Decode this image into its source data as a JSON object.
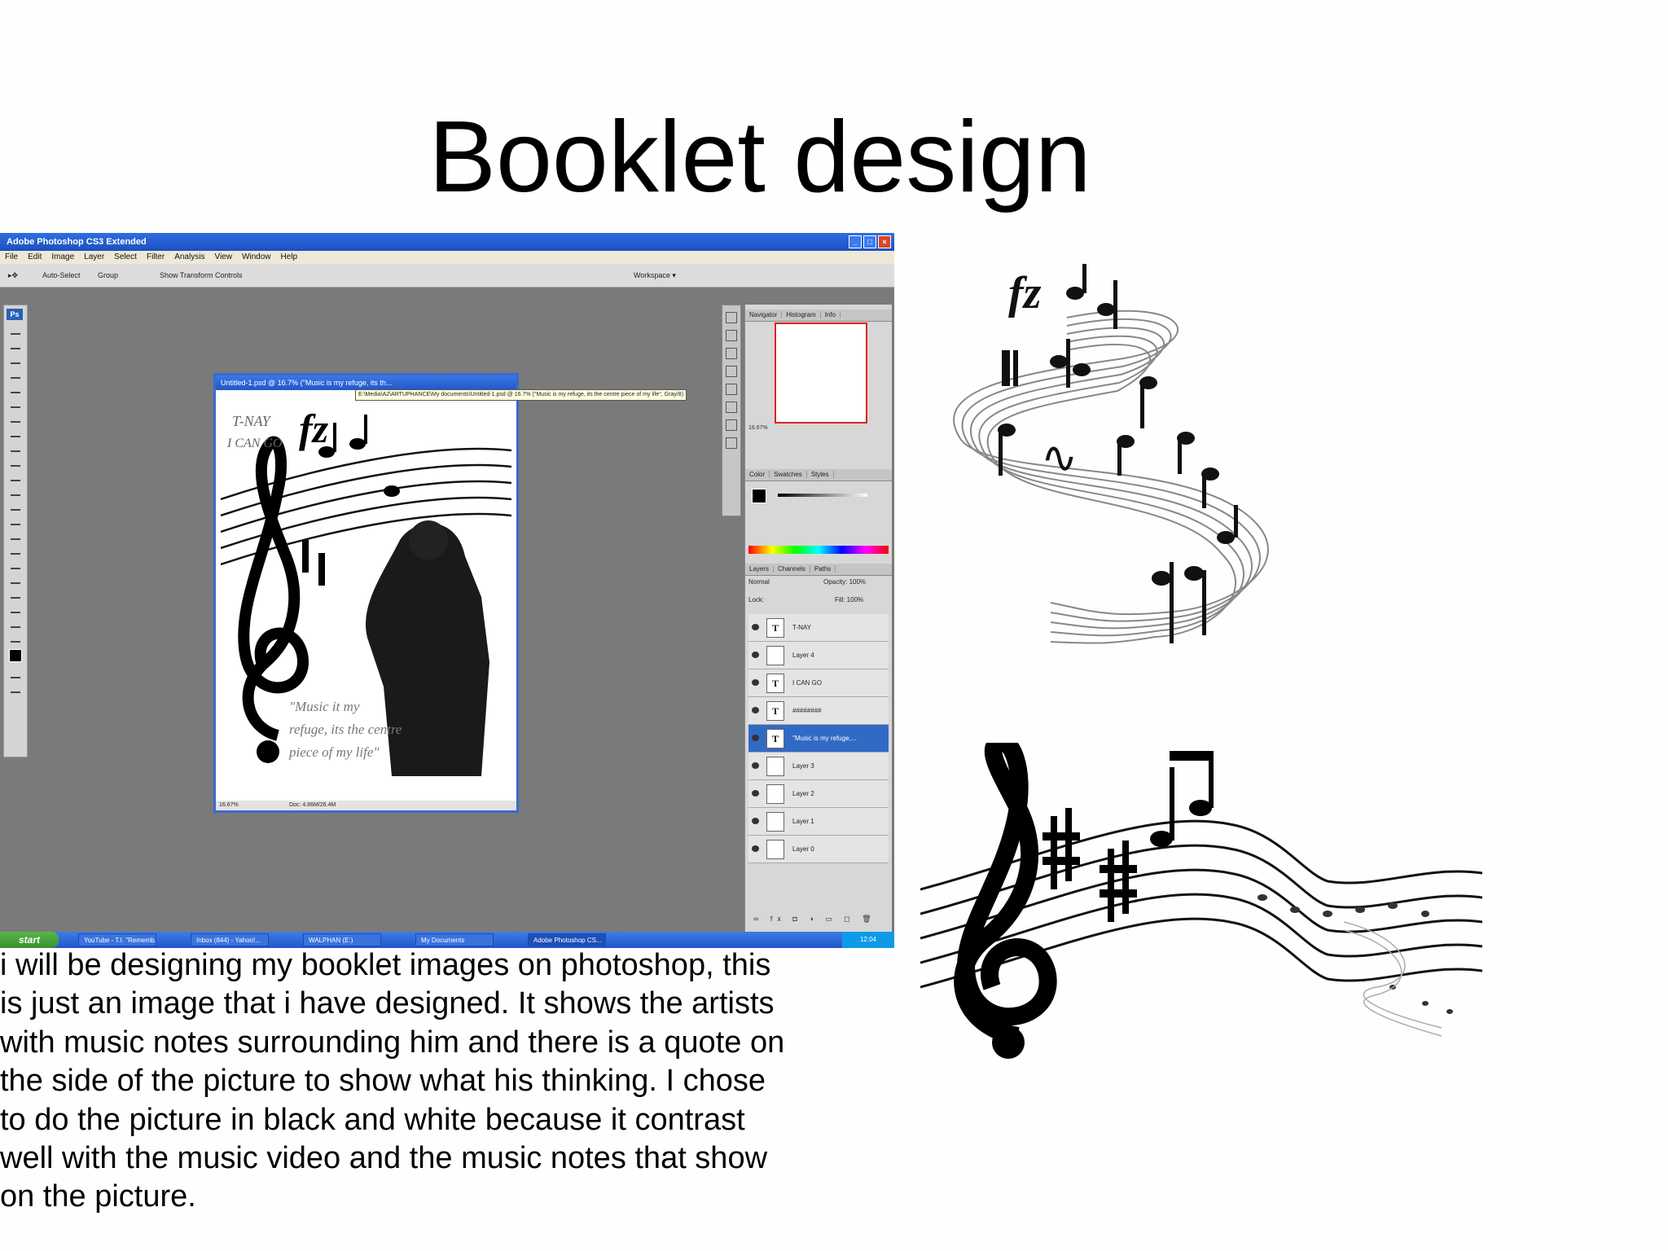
{
  "slide": {
    "title": "Booklet design",
    "body_lines": [
      "i will be designing my booklet images on photoshop, this",
      "is just an image that i have designed. It shows the artists",
      "with music notes surrounding him and there is a quote on",
      "the side of the picture to show what his thinking. I chose",
      "to do the picture in black and white because it contrast",
      "well with the music video and the music notes that show",
      "on the picture."
    ]
  },
  "photoshop": {
    "window_title": "Adobe Photoshop CS3 Extended",
    "menu": [
      "File",
      "Edit",
      "Image",
      "Layer",
      "Select",
      "Filter",
      "Analysis",
      "View",
      "Window",
      "Help"
    ],
    "options": {
      "auto_select": "Auto-Select",
      "group": "Group",
      "show_transform": "Show Transform Controls",
      "workspace": "Workspace ▾"
    },
    "toolbox_badge": "Ps",
    "document": {
      "title": "Untitled-1.psd @ 16.7% (\"Music is my refuge, its th...",
      "tooltip": "E:\\Media\\A2\\ARTUPHANCE\\My documents\\Untitled-1.psd @ 16.7% (\"Music is my refuge, its the centre piece of my life\", Gray/8)",
      "zoom": "16.67%",
      "doc_size": "Doc: 4.86M/26.4M",
      "art_text_1": "T-NAY",
      "art_text_2": "I CAN GO",
      "quote_1": "\"Music it my",
      "quote_2": "refuge, its the centre",
      "quote_3": "piece of my life\"",
      "dynamic": "fz"
    },
    "panels": {
      "nav_tabs": [
        "Navigator",
        "Histogram",
        "Info"
      ],
      "zoom": "16.67%",
      "color_tabs": [
        "Color",
        "Swatches",
        "Styles"
      ],
      "layer_tabs": [
        "Layers",
        "Channels",
        "Paths"
      ],
      "blend_mode": "Normal",
      "opacity": "Opacity: 100%",
      "lock": "Lock:",
      "fill": "Fill: 100%",
      "layers": [
        {
          "name": "T-NAY",
          "kind": "T"
        },
        {
          "name": "Layer 4",
          "kind": ""
        },
        {
          "name": "I CAN GO",
          "kind": "T"
        },
        {
          "name": "########",
          "kind": "T"
        },
        {
          "name": "\"Music is my refuge,...",
          "kind": "T"
        },
        {
          "name": "Layer 3",
          "kind": ""
        },
        {
          "name": "Layer 2",
          "kind": ""
        },
        {
          "name": "Layer 1",
          "kind": ""
        },
        {
          "name": "Layer 0",
          "kind": ""
        }
      ]
    },
    "taskbar": {
      "start": "start",
      "tasks": [
        "YouTube - T.I. \"Rememb...",
        "Inbox (844) - Yahoo!...",
        "WALPHAN (E:)",
        "My Documents",
        "Adobe Photoshop CS..."
      ],
      "clock": "12:04"
    }
  },
  "clipart": {
    "dynamic": "fz"
  },
  "colors": {
    "xp_blue": "#2156cc",
    "selected_layer": "#316ac5",
    "nav_frame": "#dd2222"
  }
}
